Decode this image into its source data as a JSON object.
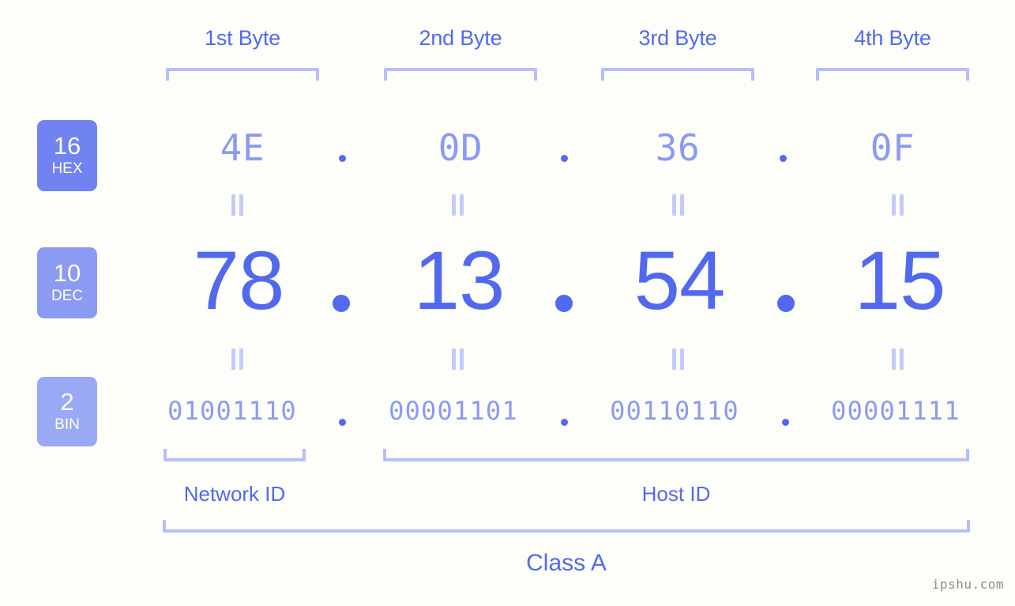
{
  "background_color": "#fdfefa",
  "accent_color": "#5269ef",
  "accent_light_color": "#8b9af2",
  "bracket_color": "#b5bffa",
  "byte_headers": [
    {
      "label": "1st Byte"
    },
    {
      "label": "2nd Byte"
    },
    {
      "label": "3rd Byte"
    },
    {
      "label": "4th Byte"
    }
  ],
  "bases": [
    {
      "num": "16",
      "sub": "HEX",
      "color": "#7083f0"
    },
    {
      "num": "10",
      "sub": "DEC",
      "color": "#8b9af2"
    },
    {
      "num": "2",
      "sub": "BIN",
      "color": "#9aa9f5"
    }
  ],
  "rows": {
    "hex": {
      "base_num": "16",
      "base_sub": "HEX",
      "values": [
        "4E",
        "0D",
        "36",
        "0F"
      ],
      "separator": "."
    },
    "dec": {
      "base_num": "10",
      "base_sub": "DEC",
      "values": [
        "78",
        "13",
        "54",
        "15"
      ],
      "separator": "."
    },
    "bin": {
      "base_num": "2",
      "base_sub": "BIN",
      "values": [
        "01001110",
        "00001101",
        "00110110",
        "00001111"
      ],
      "separator": "."
    }
  },
  "equals_symbol": "||",
  "sections": [
    {
      "label": "Network ID"
    },
    {
      "label": "Host ID"
    }
  ],
  "class": {
    "label": "Class A"
  },
  "watermark": {
    "text": "ipshu.com"
  }
}
